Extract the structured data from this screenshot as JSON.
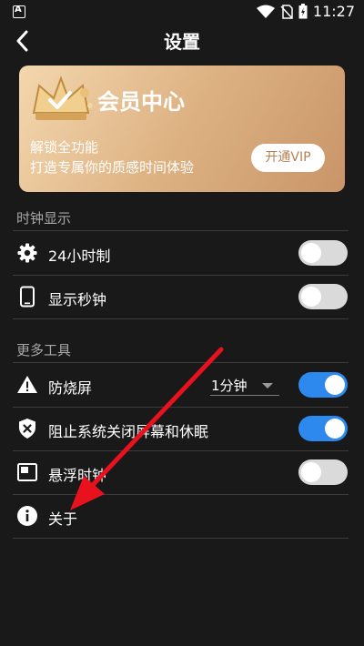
{
  "status_bar": {
    "time": "11:27"
  },
  "header": {
    "title": "设置"
  },
  "vip_card": {
    "title": "会员中心",
    "line1": "解锁全功能",
    "line2": "打造专属你的质感时间体验",
    "button": "开通VIP"
  },
  "clock_section": {
    "label": "时钟显示",
    "items": [
      {
        "label": "24小时制",
        "toggle": false
      },
      {
        "label": "显示秒钟",
        "toggle": false
      }
    ]
  },
  "tools_section": {
    "label": "更多工具",
    "items": [
      {
        "label": "防烧屏",
        "select": "1分钟",
        "toggle": true
      },
      {
        "label": "阻止系统关闭屏幕和休眠",
        "toggle": true
      },
      {
        "label": "悬浮时钟",
        "toggle": false
      },
      {
        "label": "关于"
      }
    ]
  },
  "colors": {
    "accent": "#2e89ef",
    "annotation_arrow": "#e8121e",
    "vip_gold": "#ddb283"
  }
}
